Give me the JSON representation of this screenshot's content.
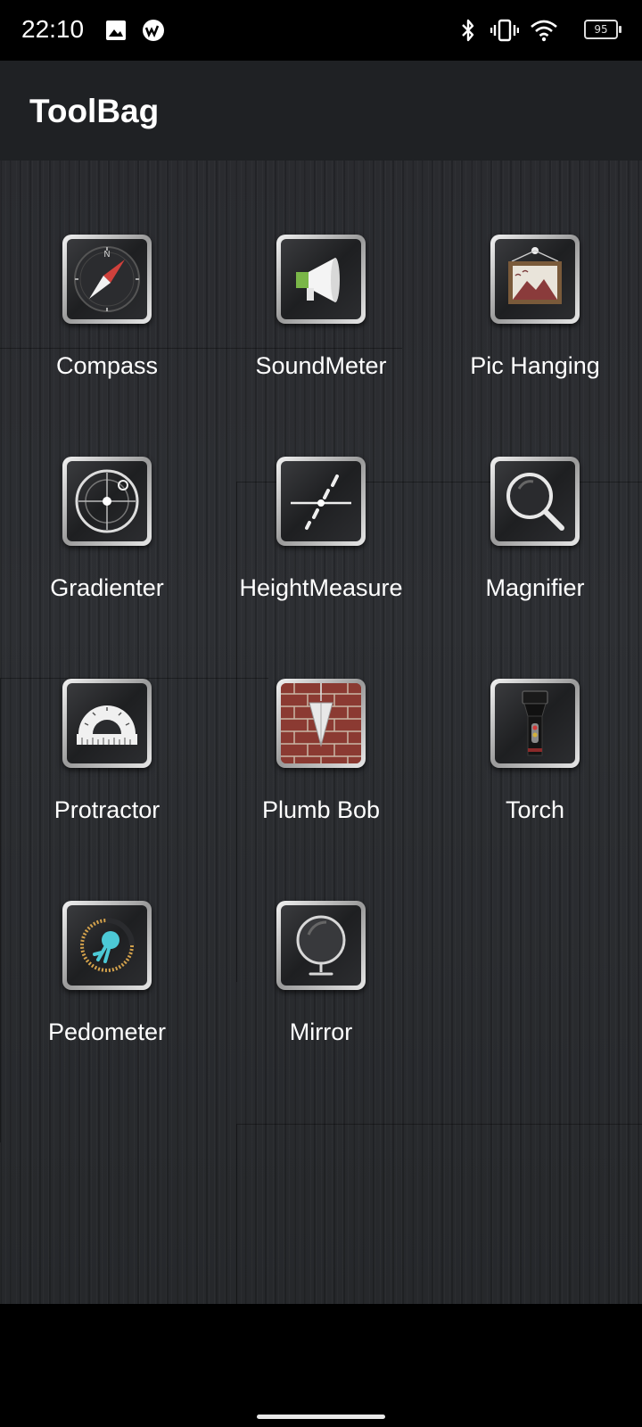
{
  "status_bar": {
    "time": "22:10",
    "battery_level": "95",
    "icons": [
      "image-notification-icon",
      "app-notification-icon",
      "bluetooth-icon",
      "vibrate-icon",
      "wifi-icon",
      "battery-icon"
    ]
  },
  "app_bar": {
    "title": "ToolBag"
  },
  "tools": [
    {
      "label": "Compass",
      "icon": "compass-icon"
    },
    {
      "label": "SoundMeter",
      "icon": "megaphone-icon"
    },
    {
      "label": "Pic Hanging",
      "icon": "picture-frame-icon"
    },
    {
      "label": "Gradienter",
      "icon": "level-icon"
    },
    {
      "label": "HeightMeasure",
      "icon": "height-measure-icon"
    },
    {
      "label": "Magnifier",
      "icon": "magnifier-icon"
    },
    {
      "label": "Protractor",
      "icon": "protractor-icon"
    },
    {
      "label": "Plumb Bob",
      "icon": "plumb-bob-icon"
    },
    {
      "label": "Torch",
      "icon": "flashlight-icon"
    },
    {
      "label": "Pedometer",
      "icon": "pedometer-icon"
    },
    {
      "label": "Mirror",
      "icon": "mirror-icon"
    }
  ],
  "colors": {
    "status_bar": "#000000",
    "app_bar": "#1f2124",
    "background": "#2a2b2f",
    "text": "#ffffff"
  }
}
